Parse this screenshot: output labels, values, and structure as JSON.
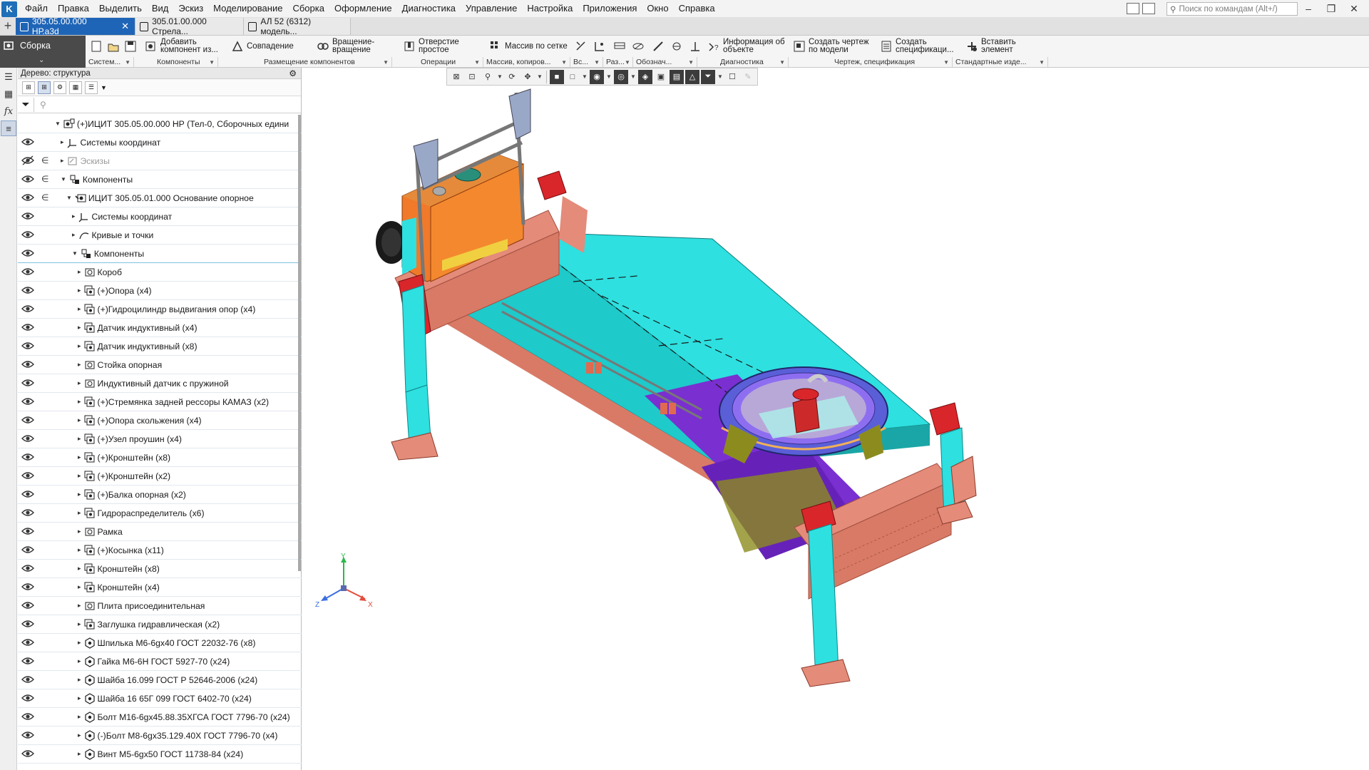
{
  "app": {
    "logo_glyph": "K"
  },
  "menu": [
    "Файл",
    "Правка",
    "Выделить",
    "Вид",
    "Эскиз",
    "Моделирование",
    "Сборка",
    "Оформление",
    "Диагностика",
    "Управление",
    "Настройка",
    "Приложения",
    "Окно",
    "Справка"
  ],
  "command_search": {
    "placeholder": "Поиск по командам (Alt+/)"
  },
  "tabs": [
    {
      "label": "305.05.00.000 НР.a3d",
      "active": true
    },
    {
      "label": "305.01.00.000 Стрела...",
      "active": false
    },
    {
      "label": "АЛ 52 (6312) модель...",
      "active": false
    }
  ],
  "mode": {
    "label": "Сборка"
  },
  "ribbon": {
    "buttons": [
      {
        "label": "Добавить\nкомпонент из...",
        "icon": "add-component-icon"
      },
      {
        "label": "Совпадение",
        "icon": "coincidence-icon"
      },
      {
        "label": "Вращение-\nвращение",
        "icon": "rotation-rotation-icon"
      },
      {
        "label": "Отверстие\nпростое",
        "icon": "simple-hole-icon"
      },
      {
        "label": "Массив по сетке",
        "icon": "grid-array-icon"
      },
      {
        "label": "Информация об\nобъекте",
        "icon": "object-info-icon"
      },
      {
        "label": "Создать чертеж\nпо модели",
        "icon": "create-drawing-icon"
      },
      {
        "label": "Создать\nспецификаци...",
        "icon": "create-spec-icon"
      },
      {
        "label": "Вставить\nэлемент",
        "icon": "insert-element-icon"
      }
    ],
    "groups": [
      "Систем...",
      "Компоненты",
      "Размещение компонентов",
      "Операции",
      "Массив, копиров...",
      "Вс...",
      "Раз...",
      "Обознач...",
      "Диагностика",
      "Чертеж, спецификация",
      "Стандартные изде..."
    ]
  },
  "tree": {
    "title": "Дерево: структура",
    "filter_placeholder": "",
    "rows": [
      {
        "label": "(+)ИЦИТ 305.05.00.000 НР (Тел-0, Сборочных едини",
        "level": 0,
        "expanded": true,
        "eye": false,
        "icon": "assembly-icon"
      },
      {
        "label": "Системы координат",
        "level": 1,
        "expanded": false,
        "eye": true,
        "icon": "coord-system-icon"
      },
      {
        "label": "Эскизы",
        "level": 1,
        "expanded": false,
        "eye": "hidden",
        "icon": "sketch-icon",
        "dim": true,
        "inc": true
      },
      {
        "label": "Компоненты",
        "level": 1,
        "expanded": true,
        "eye": true,
        "icon": "components-icon",
        "inc": true
      },
      {
        "label": "ИЦИТ 305.05.01.000 Основание опорное",
        "level": 2,
        "expanded": true,
        "eye": true,
        "icon": "subassembly-fixed-icon",
        "inc": true
      },
      {
        "label": "Системы координат",
        "level": 3,
        "expanded": false,
        "eye": true,
        "icon": "coord-system-icon"
      },
      {
        "label": "Кривые и точки",
        "level": 3,
        "expanded": false,
        "eye": true,
        "icon": "curves-icon"
      },
      {
        "label": "Компоненты",
        "level": 3,
        "expanded": true,
        "eye": true,
        "icon": "components-icon",
        "selected": true
      },
      {
        "label": "Короб",
        "level": 4,
        "expanded": false,
        "eye": true,
        "icon": "part-icon"
      },
      {
        "label": "(+)Опора (x4)",
        "level": 4,
        "expanded": false,
        "eye": true,
        "icon": "part-multi-icon"
      },
      {
        "label": "(+)Гидроцилиндр выдвигания опор (x4)",
        "level": 4,
        "expanded": false,
        "eye": true,
        "icon": "part-multi-icon"
      },
      {
        "label": "Датчик индуктивный (x4)",
        "level": 4,
        "expanded": false,
        "eye": true,
        "icon": "part-multi-icon"
      },
      {
        "label": "Датчик индуктивный (x8)",
        "level": 4,
        "expanded": false,
        "eye": true,
        "icon": "part-multi-icon"
      },
      {
        "label": "Стойка опорная",
        "level": 4,
        "expanded": false,
        "eye": true,
        "icon": "part-icon"
      },
      {
        "label": "Индуктивный датчик с пружиной",
        "level": 4,
        "expanded": false,
        "eye": true,
        "icon": "part-icon"
      },
      {
        "label": "(+)Стремянка задней  рессоры КАМАЗ (x2)",
        "level": 4,
        "expanded": false,
        "eye": true,
        "icon": "part-multi-icon"
      },
      {
        "label": "(+)Опора скольжения (x4)",
        "level": 4,
        "expanded": false,
        "eye": true,
        "icon": "part-multi-icon"
      },
      {
        "label": "(+)Узел проушин (x4)",
        "level": 4,
        "expanded": false,
        "eye": true,
        "icon": "part-multi-icon"
      },
      {
        "label": "(+)Кронштейн (x8)",
        "level": 4,
        "expanded": false,
        "eye": true,
        "icon": "part-multi-icon"
      },
      {
        "label": "(+)Кронштейн (x2)",
        "level": 4,
        "expanded": false,
        "eye": true,
        "icon": "part-multi-icon"
      },
      {
        "label": "(+)Балка опорная (x2)",
        "level": 4,
        "expanded": false,
        "eye": true,
        "icon": "part-multi-icon"
      },
      {
        "label": "Гидрораспределитель (x6)",
        "level": 4,
        "expanded": false,
        "eye": true,
        "icon": "part-multi-icon"
      },
      {
        "label": "Рамка",
        "level": 4,
        "expanded": false,
        "eye": true,
        "icon": "part-icon"
      },
      {
        "label": "(+)Косынка (x11)",
        "level": 4,
        "expanded": false,
        "eye": true,
        "icon": "part-multi-icon"
      },
      {
        "label": "Кронштейн (x8)",
        "level": 4,
        "expanded": false,
        "eye": true,
        "icon": "part-multi-icon"
      },
      {
        "label": "Кронштейн (x4)",
        "level": 4,
        "expanded": false,
        "eye": true,
        "icon": "part-multi-icon"
      },
      {
        "label": "Плита присоединительная",
        "level": 4,
        "expanded": false,
        "eye": true,
        "icon": "part-icon"
      },
      {
        "label": "Заглушка гидравлическая (x2)",
        "level": 4,
        "expanded": false,
        "eye": true,
        "icon": "part-multi-icon"
      },
      {
        "label": "Шпилька М6-6gx40 ГОСТ 22032-76 (x8)",
        "level": 4,
        "expanded": false,
        "eye": true,
        "icon": "std-part-icon"
      },
      {
        "label": "Гайка М6-6Н ГОСТ 5927-70 (x24)",
        "level": 4,
        "expanded": false,
        "eye": true,
        "icon": "std-part-icon"
      },
      {
        "label": "Шайба 16.099 ГОСТ Р 52646-2006 (x24)",
        "level": 4,
        "expanded": false,
        "eye": true,
        "icon": "std-part-icon"
      },
      {
        "label": "Шайба 16 65Г 099 ГОСТ 6402-70 (x24)",
        "level": 4,
        "expanded": false,
        "eye": true,
        "icon": "std-part-icon"
      },
      {
        "label": "Болт М16-6gx45.88.35ХГСА ГОСТ 7796-70 (x24)",
        "level": 4,
        "expanded": false,
        "eye": true,
        "icon": "std-part-icon"
      },
      {
        "label": "(-)Болт М8-6gx35.129.40Х ГОСТ 7796-70 (x4)",
        "level": 4,
        "expanded": false,
        "eye": true,
        "icon": "std-part-icon"
      },
      {
        "label": "Винт М5-6gx50 ГОСТ 11738-84 (x24)",
        "level": 4,
        "expanded": false,
        "eye": true,
        "icon": "std-part-icon"
      }
    ]
  },
  "triad": {
    "x": "X",
    "y": "Y",
    "z": "Z"
  },
  "colors": {
    "accent": "#1f65b7",
    "cyan": "#2ee0e0",
    "salmon": "#e08a78",
    "purple": "#7a2fd0",
    "orange": "#f07a2a",
    "red": "#d9262b"
  }
}
